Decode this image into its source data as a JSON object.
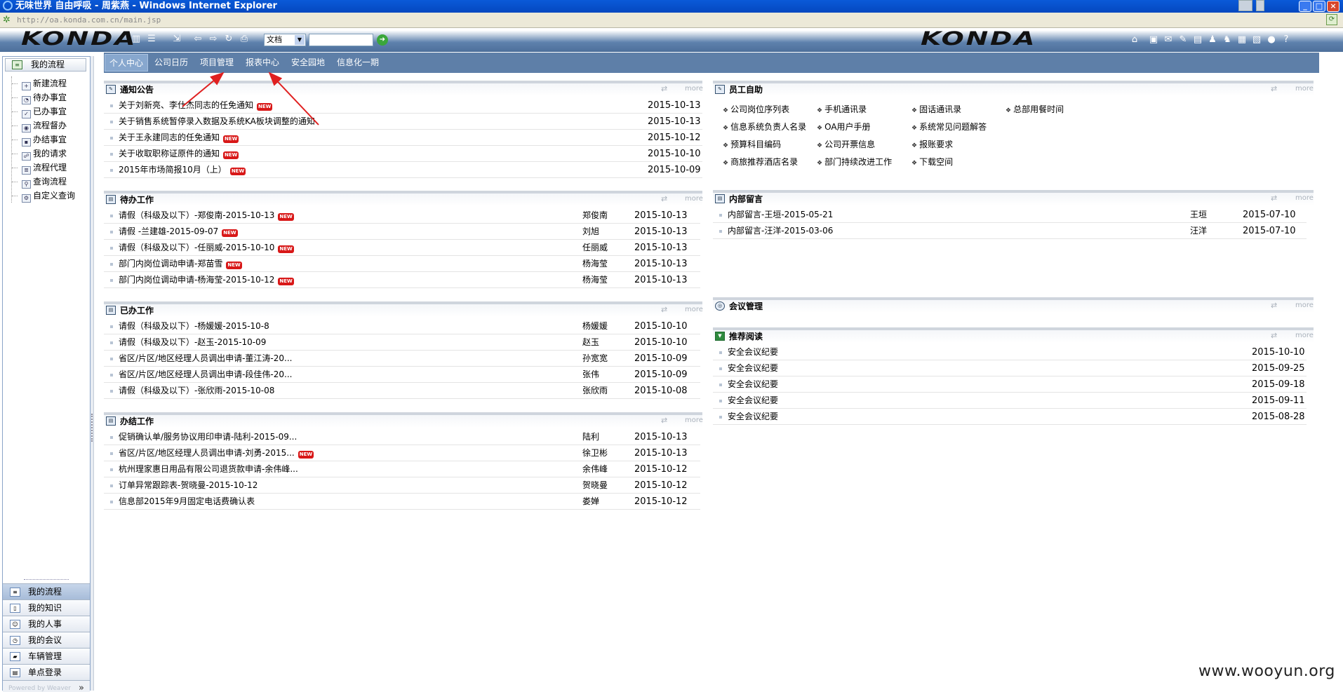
{
  "window": {
    "title": "无味世界 自由呼吸 - 周紫燕 - Windows Internet Explorer",
    "url": "http://oa.konda.com.cn/main.jsp"
  },
  "brand": {
    "logo_left": "KONDA",
    "logo_right": "KONDA"
  },
  "toolbar": {
    "doc_select": "文档",
    "search_value": ""
  },
  "icons": {
    "home": "home-icon",
    "go": "go-arrow-icon",
    "help": "help-icon"
  },
  "nav": {
    "tabs": [
      {
        "label": "个人中心"
      },
      {
        "label": "公司日历"
      },
      {
        "label": "项目管理"
      },
      {
        "label": "报表中心"
      },
      {
        "label": "安全园地"
      },
      {
        "label": "信息化一期"
      }
    ]
  },
  "sidebar": {
    "title": "我的流程",
    "items": [
      {
        "label": "新建流程"
      },
      {
        "label": "待办事宜"
      },
      {
        "label": "已办事宜"
      },
      {
        "label": "流程督办"
      },
      {
        "label": "办结事宜"
      },
      {
        "label": "我的请求"
      },
      {
        "label": "流程代理"
      },
      {
        "label": "查询流程"
      },
      {
        "label": "自定义查询"
      }
    ],
    "modules": [
      {
        "label": "我的流程"
      },
      {
        "label": "我的知识"
      },
      {
        "label": "我的人事"
      },
      {
        "label": "我的会议"
      },
      {
        "label": "车辆管理"
      },
      {
        "label": "单点登录"
      }
    ],
    "powered": "Powered by Weaver"
  },
  "common": {
    "more": "more",
    "new_badge": "NEW"
  },
  "notices": {
    "title": "通知公告",
    "rows": [
      {
        "title": "关于刘新亮、李仕杰同志的任免通知",
        "date": "2015-10-13",
        "new": true
      },
      {
        "title": "关于销售系统暂停录入数据及系统KA板块调整的通知",
        "date": "2015-10-13",
        "new": false
      },
      {
        "title": "关于王永建同志的任免通知",
        "date": "2015-10-12",
        "new": true
      },
      {
        "title": "关于收取职称证原件的通知",
        "date": "2015-10-10",
        "new": true
      },
      {
        "title": "2015年市场简报10月（上）",
        "date": "2015-10-09",
        "new": true
      }
    ]
  },
  "todo": {
    "title": "待办工作",
    "rows": [
      {
        "title": "请假（科级及以下）-郑俊南-2015-10-13",
        "who": "郑俊南",
        "date": "2015-10-13",
        "new": true
      },
      {
        "title": "请假 -兰建雄-2015-09-07",
        "who": "刘旭",
        "date": "2015-10-13",
        "new": true
      },
      {
        "title": "请假（科级及以下）-任丽威-2015-10-10",
        "who": "任丽威",
        "date": "2015-10-13",
        "new": true
      },
      {
        "title": "部门内岗位调动申请-郑苗雪",
        "who": "杨海莹",
        "date": "2015-10-13",
        "new": true
      },
      {
        "title": "部门内岗位调动申请-杨海莹-2015-10-12",
        "who": "杨海莹",
        "date": "2015-10-13",
        "new": true
      }
    ]
  },
  "done": {
    "title": "已办工作",
    "rows": [
      {
        "title": "请假（科级及以下）-杨媛媛-2015-10-8",
        "who": "杨媛媛",
        "date": "2015-10-10"
      },
      {
        "title": "请假（科级及以下）-赵玉-2015-10-09",
        "who": "赵玉",
        "date": "2015-10-10"
      },
      {
        "title": "省区/片区/地区经理人员调出申请-董江涛-20...",
        "who": "孙宽宽",
        "date": "2015-10-09"
      },
      {
        "title": "省区/片区/地区经理人员调出申请-段佳伟-20...",
        "who": "张伟",
        "date": "2015-10-09"
      },
      {
        "title": "请假（科级及以下）-张欣雨-2015-10-08",
        "who": "张欣雨",
        "date": "2015-10-08"
      }
    ]
  },
  "finished": {
    "title": "办结工作",
    "rows": [
      {
        "title": "促销确认单/服务协议用印申请-陆利-2015-09...",
        "who": "陆利",
        "date": "2015-10-13",
        "new": false
      },
      {
        "title": "省区/片区/地区经理人员调出申请-刘勇-2015...",
        "who": "徐卫彬",
        "date": "2015-10-13",
        "new": true
      },
      {
        "title": "杭州理家惠日用品有限公司退货款申请-余伟峰...",
        "who": "余伟峰",
        "date": "2015-10-12",
        "new": false
      },
      {
        "title": "订单异常跟踪表-贺晓曼-2015-10-12",
        "who": "贺晓曼",
        "date": "2015-10-12",
        "new": false
      },
      {
        "title": "信息部2015年9月固定电话费确认表",
        "who": "娄婵",
        "date": "2015-10-12",
        "new": false
      }
    ]
  },
  "selfservice": {
    "title": "员工自助",
    "links": [
      {
        "label": "公司岗位序列表"
      },
      {
        "label": "手机通讯录"
      },
      {
        "label": "固话通讯录"
      },
      {
        "label": "总部用餐时间"
      },
      {
        "label": "信息系统负责人名录"
      },
      {
        "label": "OA用户手册"
      },
      {
        "label": "系统常见问题解答"
      },
      {
        "label": "预算科目编码"
      },
      {
        "label": "公司开票信息"
      },
      {
        "label": "报账要求"
      },
      {
        "label": "商旅推荐酒店名录"
      },
      {
        "label": "部门持续改进工作"
      },
      {
        "label": "下载空间"
      }
    ]
  },
  "messages": {
    "title": "内部留言",
    "rows": [
      {
        "title": "内部留言-王垣-2015-05-21",
        "who": "王垣",
        "date": "2015-07-10"
      },
      {
        "title": "内部留言-汪洋-2015-03-06",
        "who": "汪洋",
        "date": "2015-07-10"
      }
    ]
  },
  "meeting": {
    "title": "会议管理"
  },
  "reading": {
    "title": "推荐阅读",
    "rows": [
      {
        "title": "安全会议纪要",
        "date": "2015-10-10"
      },
      {
        "title": "安全会议纪要",
        "date": "2015-09-25"
      },
      {
        "title": "安全会议纪要",
        "date": "2015-09-18"
      },
      {
        "title": "安全会议纪要",
        "date": "2015-09-11"
      },
      {
        "title": "安全会议纪要",
        "date": "2015-08-28"
      }
    ]
  },
  "watermark": "www.wooyun.org",
  "colors": {
    "nav_bg": "#5e7fa8",
    "active_tab": "#87a7ce",
    "arrow": "#e02020",
    "new_badge": "#d81818"
  }
}
